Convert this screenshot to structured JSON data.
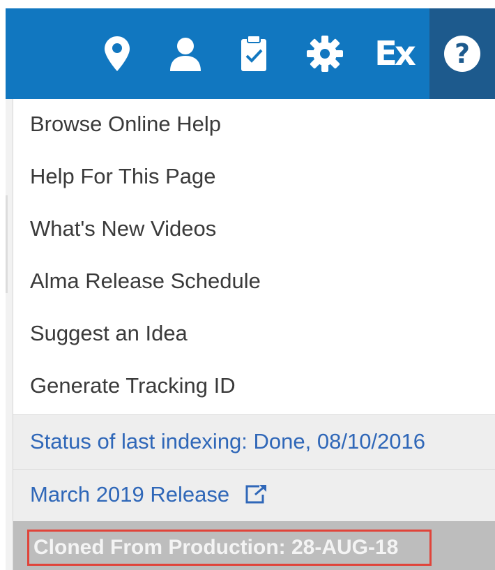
{
  "toolbar": {
    "icons": [
      "location-pin-icon",
      "user-icon",
      "tasks-clipboard-icon",
      "settings-gear-icon",
      "ex-icon",
      "help-icon"
    ],
    "ex_label": "Ex",
    "help_label": "?",
    "colors": {
      "bar": "#1177c0",
      "active": "#1d5a8d"
    }
  },
  "help_menu": {
    "items": [
      "Browse Online Help",
      "Help For This Page",
      "What's New Videos",
      "Alma Release Schedule",
      "Suggest an Idea",
      "Generate Tracking ID"
    ],
    "indexing_status": "Status of last indexing: Done, 08/10/2016",
    "release_link": "March 2019 Release",
    "cloned_note": "Cloned From Production: 28-AUG-18",
    "colors": {
      "link": "#2f67b8",
      "highlight_border": "#e0443a"
    }
  }
}
